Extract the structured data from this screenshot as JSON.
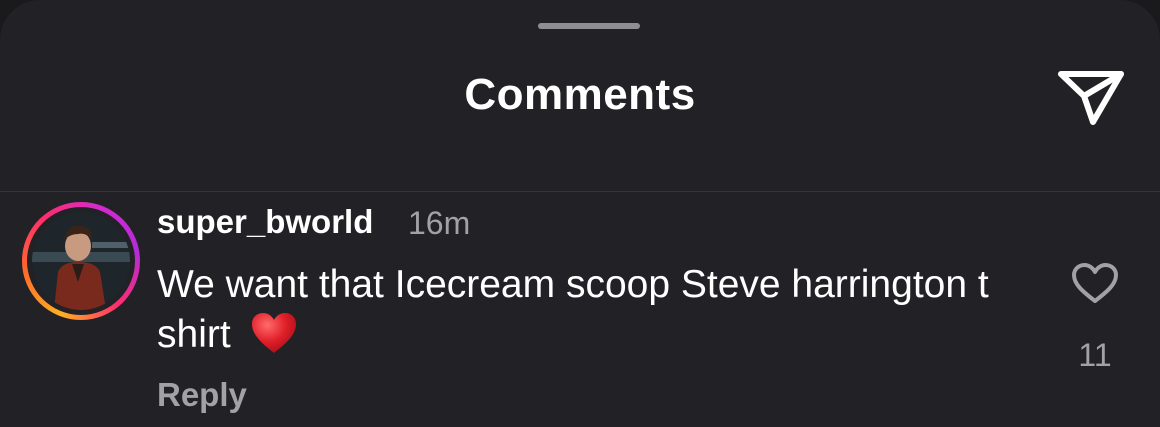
{
  "header": {
    "title": "Comments",
    "share_icon": "paper-plane-icon"
  },
  "comments": [
    {
      "username": "super_bworld",
      "time": "16m",
      "text": "We want that Icecream scoop Steve harrington t shirt",
      "emoji": "red-heart-emoji",
      "reply_label": "Reply",
      "like_icon": "heart-outline-icon",
      "like_count": "11"
    }
  ],
  "colors": {
    "background": "#222226",
    "text_primary": "#ffffff",
    "text_secondary": "#a1a1a6",
    "emoji_heart": "#e0202a",
    "story_ring": [
      "#ffb020",
      "#ff2d6f",
      "#b32cd8"
    ]
  }
}
